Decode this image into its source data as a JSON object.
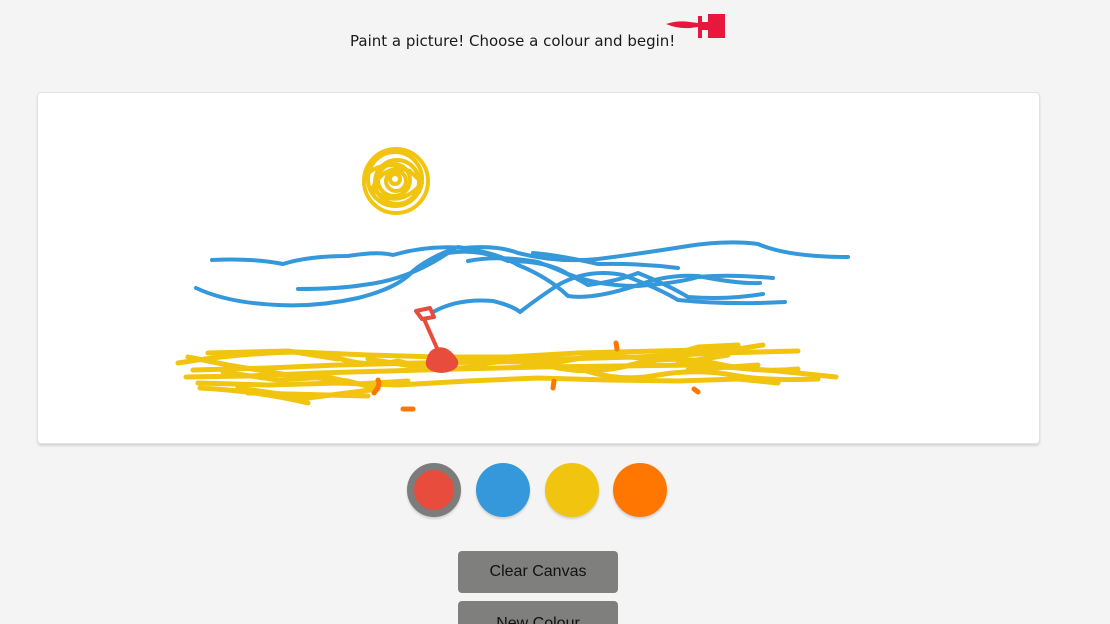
{
  "header": {
    "instruction": "Paint a picture! Choose a colour and begin!",
    "icon": "paintbrush-icon",
    "icon_color": "#e8173c"
  },
  "canvas": {
    "background": "#ffffff",
    "drawing_colors": {
      "sun": "#f1c40f",
      "sea": "#3498db",
      "sand": "#f1c40f",
      "spade": "#e74c3c",
      "dots": "#ff7700"
    }
  },
  "palette": {
    "selected": "red",
    "swatches": [
      {
        "name": "red",
        "color": "#e74c3c"
      },
      {
        "name": "blue",
        "color": "#3498db"
      },
      {
        "name": "yellow",
        "color": "#f1c40f"
      },
      {
        "name": "orange",
        "color": "#ff7700"
      }
    ]
  },
  "buttons": {
    "clear_label": "Clear Canvas",
    "new_colour_label": "New Colour"
  }
}
